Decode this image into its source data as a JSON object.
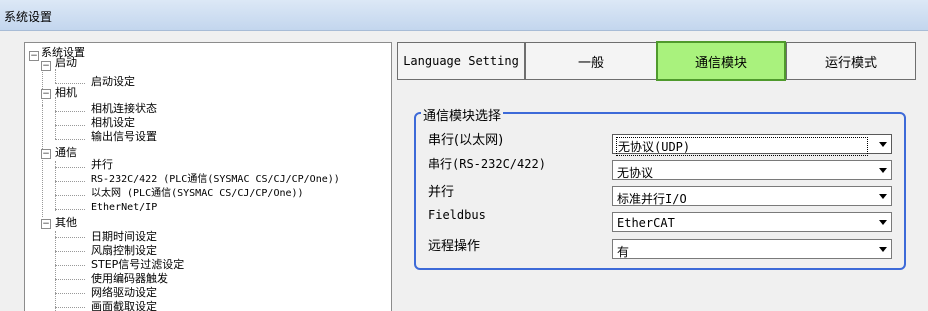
{
  "window": {
    "title": "系统设置"
  },
  "tree": {
    "root": "系统设置",
    "startup": "启动",
    "startup_settings": "启动设定",
    "camera": "相机",
    "camera_conn_status": "相机连接状态",
    "camera_settings": "相机设定",
    "output_signal": "输出信号设置",
    "comm": "通信",
    "parallel": "并行",
    "rs232": "RS-232C/422 (PLC通信(SYSMAC CS/CJ/CP/One))",
    "ethernet": "以太网 (PLC通信(SYSMAC CS/CJ/CP/One))",
    "ethernetip": "EtherNet/IP",
    "other": "其他",
    "datetime": "日期时间设定",
    "fan": "风扇控制设定",
    "step_filter": "STEP信号过滤设定",
    "encoder": "使用编码器触发",
    "network_drive": "网络驱动设定",
    "screen_capture": "画面截取设定"
  },
  "tabs": [
    {
      "label": "Language Setting"
    },
    {
      "label": "一般"
    },
    {
      "label": "通信模块",
      "active": true
    },
    {
      "label": "运行模式"
    }
  ],
  "comm_module": {
    "group_title": "通信模块选择",
    "rows": [
      {
        "label": "串行(以太网)",
        "value": "无协议(UDP)"
      },
      {
        "label": "串行(RS-232C/422)",
        "value": "无协议"
      },
      {
        "label": "并行",
        "value": "标准并行I/O"
      },
      {
        "label": "Fieldbus",
        "value": "EtherCAT"
      },
      {
        "label": "远程操作",
        "value": "有"
      }
    ]
  },
  "colors": {
    "active_tab": "#a9f27d",
    "group_border": "#3d6ad8"
  }
}
